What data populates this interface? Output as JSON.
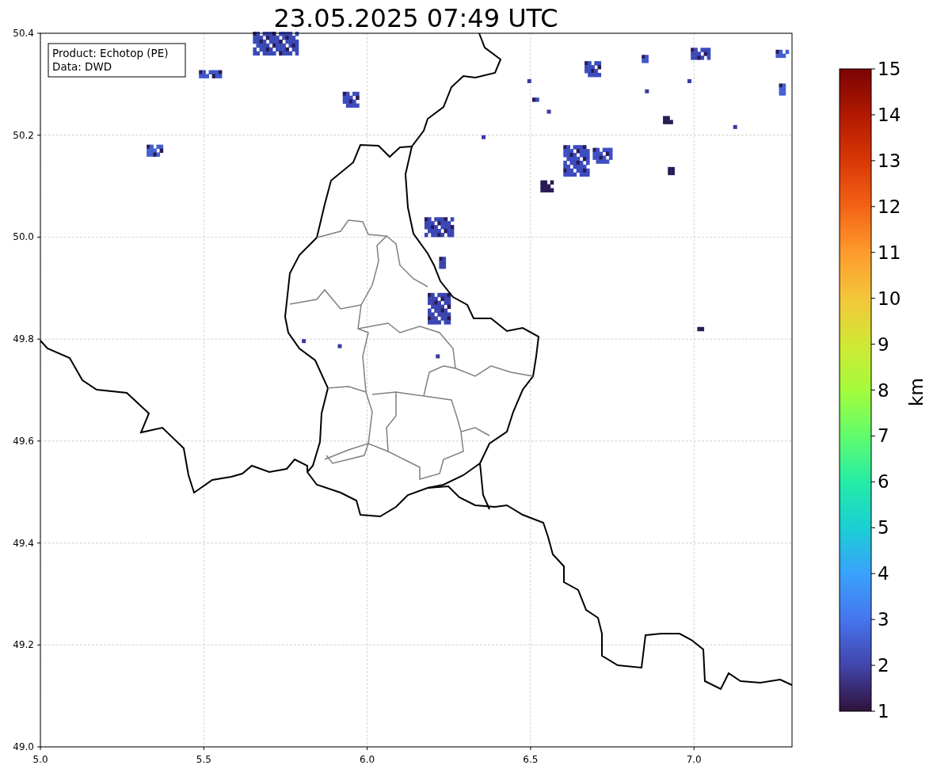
{
  "title": "23.05.2025 07:49 UTC",
  "info_box": [
    "Product: Echotop (PE)",
    "Data: DWD"
  ],
  "x_ticks": [
    "5.0",
    "5.5",
    "6.0",
    "6.5",
    "7.0"
  ],
  "y_ticks": [
    "50.4",
    "50.2",
    "50.0",
    "49.8",
    "49.6",
    "49.4",
    "49.2",
    "49.0"
  ],
  "colorbar": {
    "label": "km",
    "ticks": [
      "15",
      "14",
      "13",
      "12",
      "11",
      "10",
      "9",
      "8",
      "7",
      "6",
      "5",
      "4",
      "3",
      "2",
      "1"
    ]
  }
}
